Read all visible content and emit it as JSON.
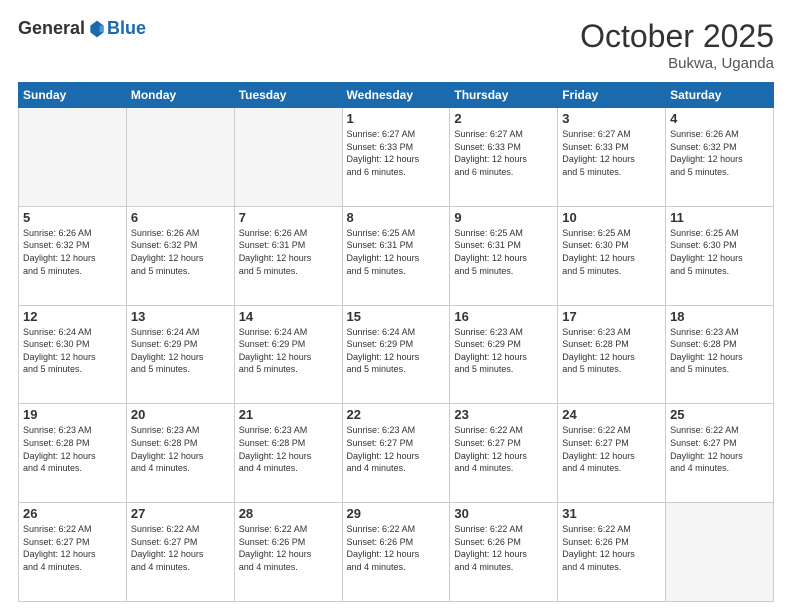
{
  "logo": {
    "general": "General",
    "blue": "Blue"
  },
  "header": {
    "month": "October 2025",
    "location": "Bukwa, Uganda"
  },
  "weekdays": [
    "Sunday",
    "Monday",
    "Tuesday",
    "Wednesday",
    "Thursday",
    "Friday",
    "Saturday"
  ],
  "weeks": [
    [
      {
        "day": "",
        "info": ""
      },
      {
        "day": "",
        "info": ""
      },
      {
        "day": "",
        "info": ""
      },
      {
        "day": "1",
        "info": "Sunrise: 6:27 AM\nSunset: 6:33 PM\nDaylight: 12 hours\nand 6 minutes."
      },
      {
        "day": "2",
        "info": "Sunrise: 6:27 AM\nSunset: 6:33 PM\nDaylight: 12 hours\nand 6 minutes."
      },
      {
        "day": "3",
        "info": "Sunrise: 6:27 AM\nSunset: 6:33 PM\nDaylight: 12 hours\nand 5 minutes."
      },
      {
        "day": "4",
        "info": "Sunrise: 6:26 AM\nSunset: 6:32 PM\nDaylight: 12 hours\nand 5 minutes."
      }
    ],
    [
      {
        "day": "5",
        "info": "Sunrise: 6:26 AM\nSunset: 6:32 PM\nDaylight: 12 hours\nand 5 minutes."
      },
      {
        "day": "6",
        "info": "Sunrise: 6:26 AM\nSunset: 6:32 PM\nDaylight: 12 hours\nand 5 minutes."
      },
      {
        "day": "7",
        "info": "Sunrise: 6:26 AM\nSunset: 6:31 PM\nDaylight: 12 hours\nand 5 minutes."
      },
      {
        "day": "8",
        "info": "Sunrise: 6:25 AM\nSunset: 6:31 PM\nDaylight: 12 hours\nand 5 minutes."
      },
      {
        "day": "9",
        "info": "Sunrise: 6:25 AM\nSunset: 6:31 PM\nDaylight: 12 hours\nand 5 minutes."
      },
      {
        "day": "10",
        "info": "Sunrise: 6:25 AM\nSunset: 6:30 PM\nDaylight: 12 hours\nand 5 minutes."
      },
      {
        "day": "11",
        "info": "Sunrise: 6:25 AM\nSunset: 6:30 PM\nDaylight: 12 hours\nand 5 minutes."
      }
    ],
    [
      {
        "day": "12",
        "info": "Sunrise: 6:24 AM\nSunset: 6:30 PM\nDaylight: 12 hours\nand 5 minutes."
      },
      {
        "day": "13",
        "info": "Sunrise: 6:24 AM\nSunset: 6:29 PM\nDaylight: 12 hours\nand 5 minutes."
      },
      {
        "day": "14",
        "info": "Sunrise: 6:24 AM\nSunset: 6:29 PM\nDaylight: 12 hours\nand 5 minutes."
      },
      {
        "day": "15",
        "info": "Sunrise: 6:24 AM\nSunset: 6:29 PM\nDaylight: 12 hours\nand 5 minutes."
      },
      {
        "day": "16",
        "info": "Sunrise: 6:23 AM\nSunset: 6:29 PM\nDaylight: 12 hours\nand 5 minutes."
      },
      {
        "day": "17",
        "info": "Sunrise: 6:23 AM\nSunset: 6:28 PM\nDaylight: 12 hours\nand 5 minutes."
      },
      {
        "day": "18",
        "info": "Sunrise: 6:23 AM\nSunset: 6:28 PM\nDaylight: 12 hours\nand 5 minutes."
      }
    ],
    [
      {
        "day": "19",
        "info": "Sunrise: 6:23 AM\nSunset: 6:28 PM\nDaylight: 12 hours\nand 4 minutes."
      },
      {
        "day": "20",
        "info": "Sunrise: 6:23 AM\nSunset: 6:28 PM\nDaylight: 12 hours\nand 4 minutes."
      },
      {
        "day": "21",
        "info": "Sunrise: 6:23 AM\nSunset: 6:28 PM\nDaylight: 12 hours\nand 4 minutes."
      },
      {
        "day": "22",
        "info": "Sunrise: 6:23 AM\nSunset: 6:27 PM\nDaylight: 12 hours\nand 4 minutes."
      },
      {
        "day": "23",
        "info": "Sunrise: 6:22 AM\nSunset: 6:27 PM\nDaylight: 12 hours\nand 4 minutes."
      },
      {
        "day": "24",
        "info": "Sunrise: 6:22 AM\nSunset: 6:27 PM\nDaylight: 12 hours\nand 4 minutes."
      },
      {
        "day": "25",
        "info": "Sunrise: 6:22 AM\nSunset: 6:27 PM\nDaylight: 12 hours\nand 4 minutes."
      }
    ],
    [
      {
        "day": "26",
        "info": "Sunrise: 6:22 AM\nSunset: 6:27 PM\nDaylight: 12 hours\nand 4 minutes."
      },
      {
        "day": "27",
        "info": "Sunrise: 6:22 AM\nSunset: 6:27 PM\nDaylight: 12 hours\nand 4 minutes."
      },
      {
        "day": "28",
        "info": "Sunrise: 6:22 AM\nSunset: 6:26 PM\nDaylight: 12 hours\nand 4 minutes."
      },
      {
        "day": "29",
        "info": "Sunrise: 6:22 AM\nSunset: 6:26 PM\nDaylight: 12 hours\nand 4 minutes."
      },
      {
        "day": "30",
        "info": "Sunrise: 6:22 AM\nSunset: 6:26 PM\nDaylight: 12 hours\nand 4 minutes."
      },
      {
        "day": "31",
        "info": "Sunrise: 6:22 AM\nSunset: 6:26 PM\nDaylight: 12 hours\nand 4 minutes."
      },
      {
        "day": "",
        "info": ""
      }
    ]
  ]
}
